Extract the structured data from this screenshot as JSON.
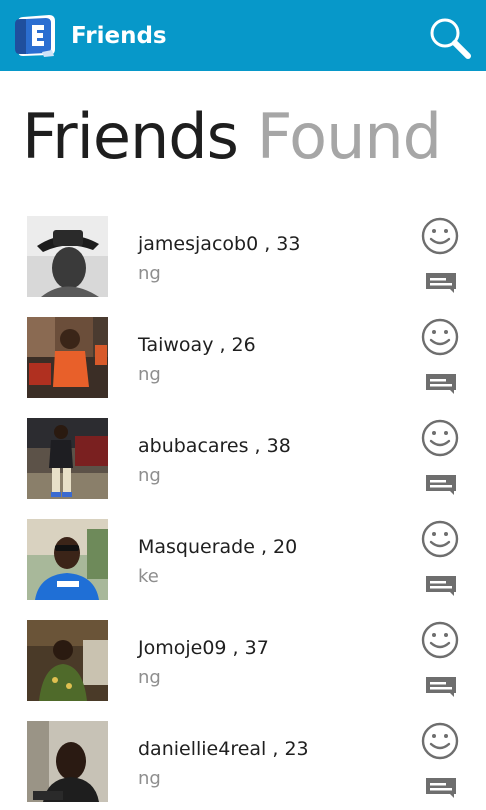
{
  "app_bar": {
    "title": "Friends",
    "logo_icon": "app-logo-icon",
    "search_icon": "search-icon",
    "background_color": "#0798c9"
  },
  "header": {
    "primary": "Friends",
    "secondary": "Found"
  },
  "friends": [
    {
      "label": "jamesjacob0 , 33",
      "country": "ng"
    },
    {
      "label": "Taiwoay , 26",
      "country": "ng"
    },
    {
      "label": "abubacares , 38",
      "country": "ng"
    },
    {
      "label": "Masquerade , 20",
      "country": "ke"
    },
    {
      "label": "Jomoje09 , 37",
      "country": "ng"
    },
    {
      "label": "daniellie4real , 23",
      "country": "ng"
    }
  ],
  "row_actions": {
    "like_icon": "smiley-icon",
    "message_icon": "message-icon",
    "icon_color": "#6e6e6e"
  }
}
